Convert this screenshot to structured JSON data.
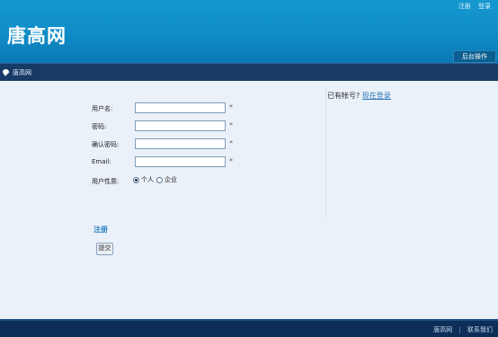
{
  "header": {
    "logo_text": "唐高网",
    "top_links": [
      "注册",
      "登录"
    ],
    "admin_tab": "后台操作"
  },
  "subnav": {
    "breadcrumb": "唐高网"
  },
  "form": {
    "fields": [
      {
        "label": "用户名:",
        "value": "",
        "required_mark": "*"
      },
      {
        "label": "密码:",
        "value": "",
        "required_mark": "*"
      },
      {
        "label": "确认密码:",
        "value": "",
        "required_mark": "*"
      },
      {
        "label": "Email:",
        "value": "",
        "required_mark": "*"
      }
    ],
    "gender": {
      "label": "用户性质:",
      "options": [
        "个人",
        "企业"
      ],
      "selected": "个人"
    },
    "section_title": "注册",
    "submit_label": "提交"
  },
  "sidebar": {
    "prompt": "已有帐号?",
    "login_link": "现在登录"
  },
  "footer": {
    "links": [
      "唐高网",
      "联系我们"
    ],
    "separator": "|"
  }
}
